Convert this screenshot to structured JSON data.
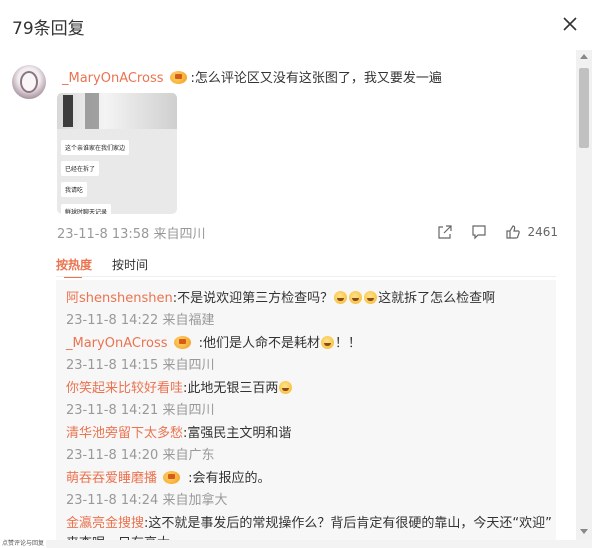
{
  "header": {
    "title": "79条回复"
  },
  "main_comment": {
    "username": "_MaryOnACross",
    "text": ":怎么评论区又没有这张图了，我又要发一遍",
    "timestamp": "23-11-8 13:58 来自四川",
    "likes": "2461",
    "image_bubbles": [
      "这个亲谁家在我们家边",
      "已经在拆了",
      "我请吃",
      "鲜球时聊天记录"
    ]
  },
  "tabs": {
    "hot": "按热度",
    "time": "按时间"
  },
  "replies": [
    {
      "user": "阿shenshenshen",
      "text_a": ":不是说欢迎第三方检查吗？",
      "text_b": "这就拆了怎么检查啊",
      "meta": "23-11-8 14:22 来自福建"
    },
    {
      "user": "_MaryOnACross",
      "text_a": " :他们是人命不是耗材",
      "text_b": "！！",
      "meta": "23-11-8 14:15 来自四川"
    },
    {
      "user": "你笑起来比较好看哇",
      "text_a": ":此地无银三百两",
      "meta": "23-11-8 14:21 来自四川"
    },
    {
      "user": "清华池旁留下太多愁",
      "text_a": ":富强民主文明和谐",
      "meta": "23-11-8 14:20 来自广东"
    },
    {
      "user": "萌吞吞爱睡磨播",
      "text_a": " :会有报应的。",
      "meta": "23-11-8 14:24 来自加拿大"
    },
    {
      "user": "金瀛亮金搜搜",
      "text_a": ":这不就是事发后的常规操作么？背后肯定有很硬的靠山，今天还“欢迎”"
    }
  ],
  "partial_line": "来查呢…只有高大",
  "taskbar_tip": "点赞评论与回复",
  "colors": {
    "accent": "#eb7350",
    "meta": "#999999",
    "reply_bg": "#f7f7f7"
  }
}
